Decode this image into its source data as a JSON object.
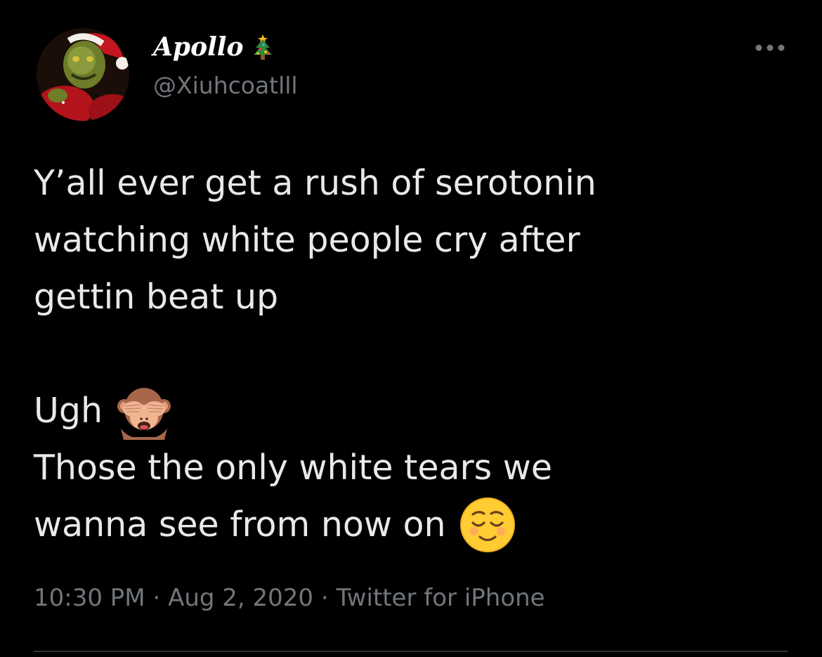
{
  "author": {
    "display_name": "Apollo",
    "display_name_icon": "christmas-tree-icon",
    "handle": "@Xiuhcoatlll",
    "avatar_icon": "grinch-santa-avatar"
  },
  "tweet": {
    "lines": [
      "Y’all ever get a rush of serotonin",
      "watching white people cry after",
      "gettin beat up",
      "Ugh",
      "Those the only white tears we",
      "wanna see from now on"
    ],
    "emojis": {
      "line4": "see-no-evil-monkey-icon",
      "line6": "relieved-face-icon"
    }
  },
  "meta": {
    "time": "10:30 PM",
    "separator": "·",
    "date": "Aug 2, 2020",
    "source": "Twitter for iPhone"
  },
  "more_options_icon": "more-dots-icon",
  "colors": {
    "background": "#000000",
    "text_primary": "#e7e9ea",
    "text_secondary": "#71767b",
    "divider": "#2f3336"
  }
}
